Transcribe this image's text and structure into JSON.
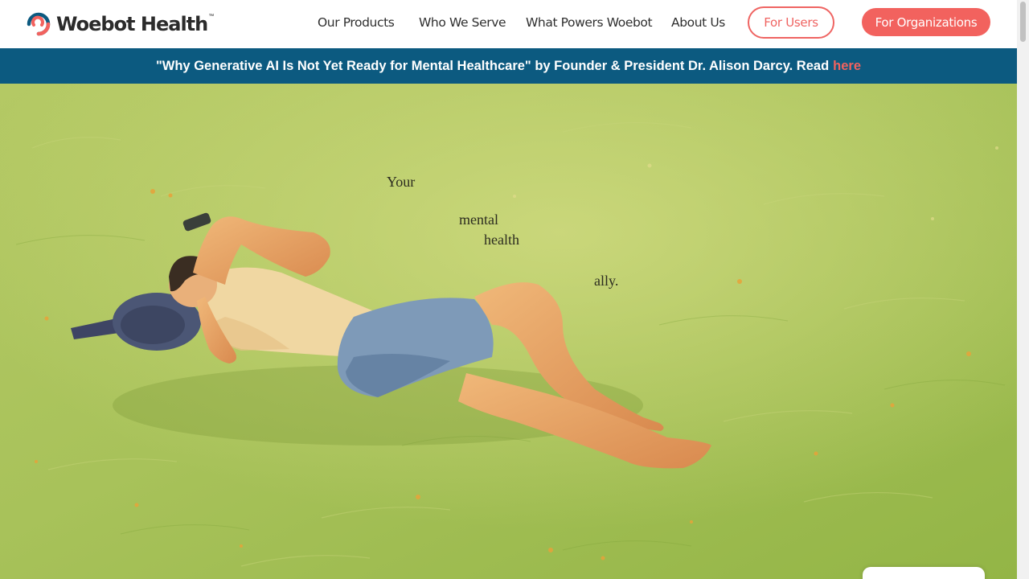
{
  "brand": {
    "name": "Woebot Health",
    "tm": "™"
  },
  "nav": {
    "links": [
      "Our Products",
      "Who We Serve",
      "What Powers Woebot",
      "About Us"
    ],
    "for_users": "For Users",
    "for_orgs": "For Organizations"
  },
  "banner": {
    "text": "\"Why Generative AI Is Not Yet Ready for Mental Healthcare\" by Founder & President Dr. Alison Darcy. Read",
    "link": "here"
  },
  "hero": {
    "tagline": [
      "Your",
      "mental",
      "health",
      "ally."
    ]
  },
  "colors": {
    "accent": "#f2625e",
    "banner_bg": "#0c5a80",
    "grass": "#a9c457"
  },
  "icons": [
    "woebot-logo-icon"
  ]
}
